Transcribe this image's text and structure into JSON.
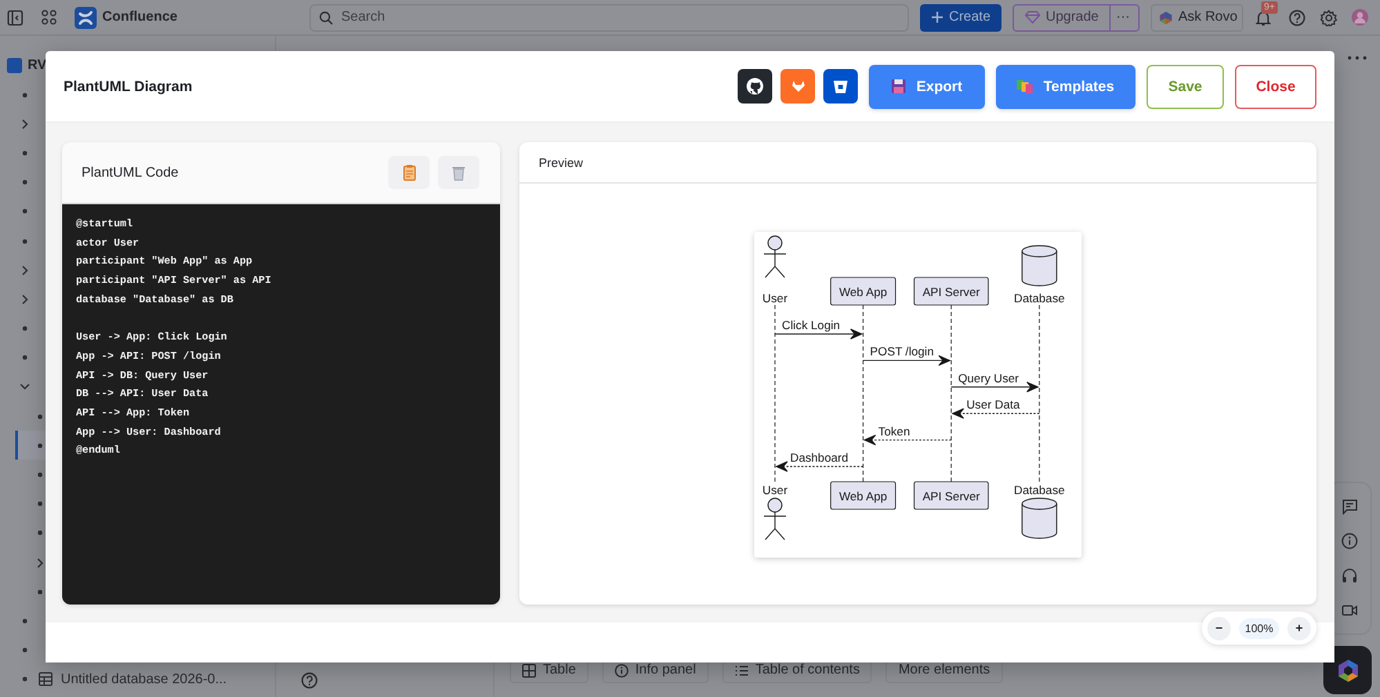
{
  "topbar": {
    "app_name": "Confluence",
    "search": {
      "placeholder": "Search"
    },
    "buttons": [
      {
        "kind": "create",
        "label": "Create"
      },
      {
        "kind": "upgrade",
        "label": "Upgrade"
      },
      {
        "kind": "more",
        "label": "···"
      },
      {
        "kind": "rovo",
        "label": "Ask Rovo"
      }
    ],
    "notifications_badge": "9+"
  },
  "sidebar": {
    "space": "RV",
    "items": [
      {
        "kind": "bullet",
        "selected": false
      },
      {
        "kind": "folder",
        "expanded": false,
        "selected": false
      },
      {
        "kind": "bullet",
        "selected": false
      },
      {
        "kind": "bullet",
        "selected": false
      },
      {
        "kind": "bullet",
        "selected": false
      },
      {
        "kind": "bullet",
        "selected": false
      },
      {
        "kind": "folder",
        "expanded": false,
        "selected": false
      },
      {
        "kind": "folder",
        "expanded": false,
        "selected": false
      },
      {
        "kind": "bullet",
        "selected": false
      },
      {
        "kind": "bullet",
        "selected": false
      },
      {
        "kind": "folder",
        "expanded": true,
        "selected": false,
        "children": [
          {
            "kind": "bullet",
            "selected": false
          },
          {
            "kind": "bullet",
            "selected": true
          },
          {
            "kind": "bullet",
            "selected": false
          },
          {
            "kind": "bullet",
            "selected": false
          },
          {
            "kind": "bullet",
            "selected": false
          },
          {
            "kind": "folder",
            "expanded": false,
            "selected": false
          },
          {
            "kind": "bullet",
            "selected": false
          }
        ]
      },
      {
        "kind": "bullet",
        "selected": false
      },
      {
        "kind": "bullet",
        "selected": false
      },
      {
        "kind": "database",
        "label": "Untitled database 2026-0...",
        "selected": false
      }
    ]
  },
  "editor_toolbar": {
    "buttons": [
      {
        "kind": "table",
        "label": "Table"
      },
      {
        "kind": "info",
        "label": "Info panel"
      },
      {
        "kind": "toc",
        "label": "Table of contents"
      },
      {
        "kind": "more",
        "label": "More elements"
      }
    ]
  },
  "modal": {
    "title": "PlantUML Diagram",
    "icon_buttons": [
      {
        "kind": "github"
      },
      {
        "kind": "gitlab"
      },
      {
        "kind": "bitbucket"
      }
    ],
    "buttons": [
      {
        "kind": "export",
        "label": "Export"
      },
      {
        "kind": "templates",
        "label": "Templates"
      },
      {
        "kind": "save",
        "label": "Save"
      },
      {
        "kind": "close",
        "label": "Close"
      }
    ],
    "code_panel": {
      "title": "PlantUML Code",
      "blocks": [
        [
          "@startuml",
          "actor User",
          "participant \"Web App\" as App",
          "participant \"API Server\" as API",
          "database \"Database\" as DB"
        ],
        [
          "User -> App: Click Login",
          "App -> API: POST /login",
          "API -> DB: Query User",
          "DB --> API: User Data",
          "API --> App: Token",
          "App --> User: Dashboard",
          "@enduml"
        ]
      ]
    },
    "preview": {
      "title": "Preview",
      "diagram": {
        "participants": [
          {
            "kind": "actor",
            "name": "User",
            "footer_name": "User"
          },
          {
            "kind": "participant",
            "name": "Web App",
            "footer_name": "Web App"
          },
          {
            "kind": "participant",
            "name": "API Server",
            "footer_name": "API Server"
          },
          {
            "kind": "database",
            "name": "Database",
            "footer_name": "Database"
          }
        ],
        "messages": [
          {
            "kind": "sync",
            "label": "Click Login"
          },
          {
            "kind": "sync",
            "label": "POST /login"
          },
          {
            "kind": "sync",
            "label": "Query User"
          },
          {
            "kind": "reply",
            "label": "User Data"
          },
          {
            "kind": "reply",
            "label": "Token"
          },
          {
            "kind": "reply",
            "label": "Dashboard"
          }
        ]
      }
    },
    "zoom": {
      "minus": "−",
      "level": "100%",
      "plus": "+"
    }
  }
}
